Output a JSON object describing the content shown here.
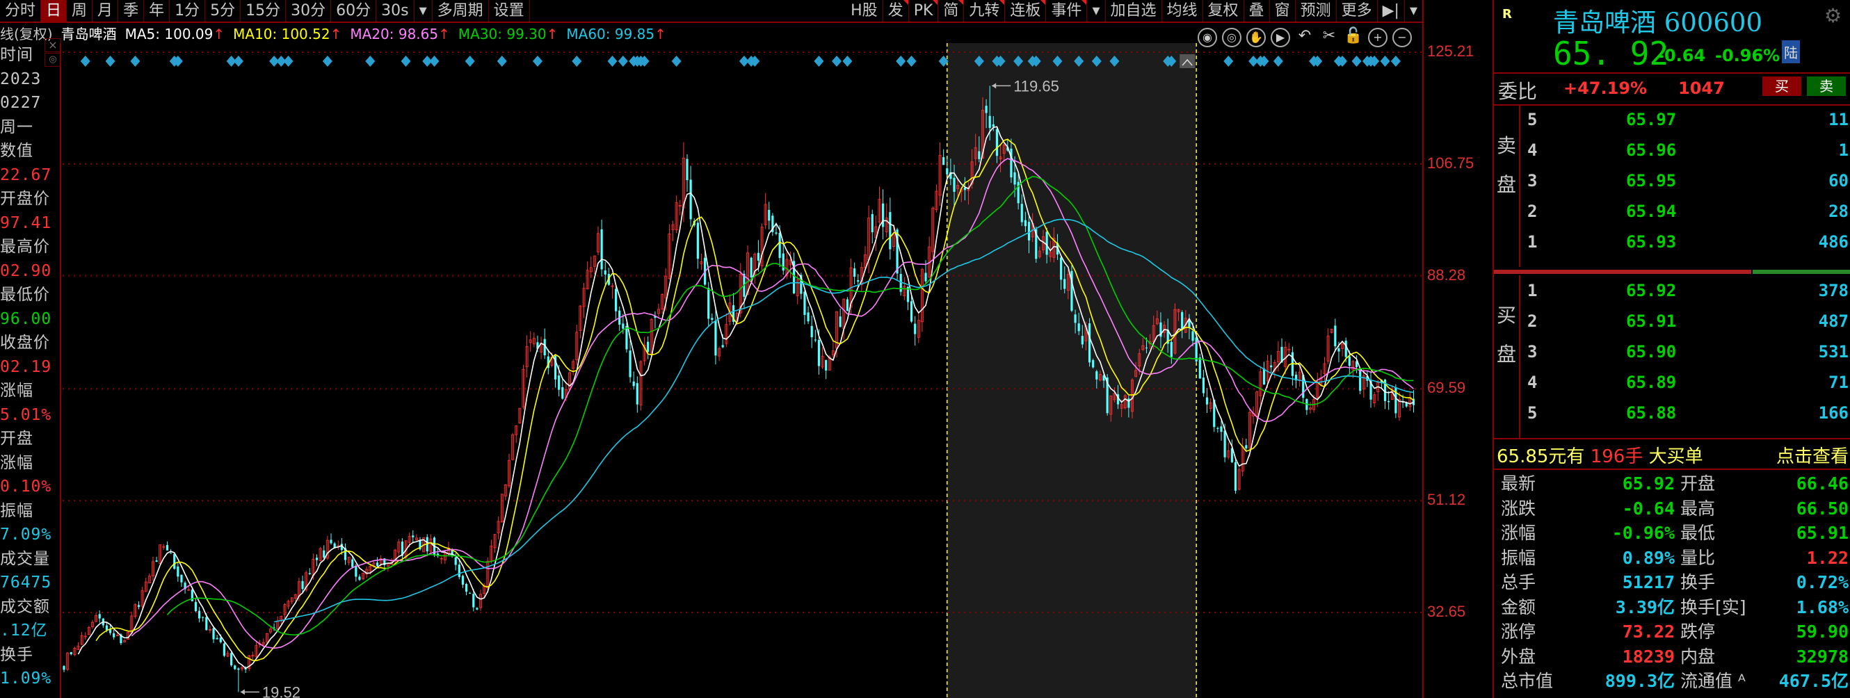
{
  "toolbar": {
    "left": [
      "分时",
      "日",
      "周",
      "月",
      "季",
      "年",
      "1分",
      "5分",
      "15分",
      "30分",
      "60分",
      "30s",
      "▾",
      "多周期",
      "设置"
    ],
    "selected": "日",
    "right": [
      "H股",
      "发",
      "PK",
      "简",
      "九转",
      "连板",
      "事件",
      "▾",
      "加自选",
      "均线",
      "复权",
      "叠",
      "窗",
      "预测",
      "更多",
      "▶|",
      "▾"
    ],
    "flagged": [
      "发",
      "PK",
      "简",
      "九转",
      "连板",
      "事件"
    ]
  },
  "ma_bar": {
    "prefix": "线(复权)",
    "name": "青岛啤酒",
    "arrow": "↑",
    "items": [
      {
        "label": "MA5: 100.09",
        "color": "#ffffff"
      },
      {
        "label": "MA10: 100.52",
        "color": "#ffff00"
      },
      {
        "label": "MA20: 98.65",
        "color": "#ff80ff"
      },
      {
        "label": "MA30: 99.30",
        "color": "#00d000"
      },
      {
        "label": "MA60: 99.85",
        "color": "#1ec8e6"
      }
    ]
  },
  "left_panel": {
    "close": "×",
    "eye": "◎",
    "rows": [
      {
        "t": "时间",
        "c": "#c8c8c8"
      },
      {
        "t": "2023",
        "c": "#c8c8c8"
      },
      {
        "t": "0227",
        "c": "#c8c8c8"
      },
      {
        "t": "周一",
        "c": "#c8c8c8"
      },
      {
        "t": "数值",
        "c": "#c8c8c8"
      },
      {
        "t": "22.67",
        "c": "#ff3232"
      },
      {
        "t": "开盘价",
        "c": "#c8c8c8"
      },
      {
        "t": "97.41",
        "c": "#ff3232"
      },
      {
        "t": "最高价",
        "c": "#c8c8c8"
      },
      {
        "t": "02.90",
        "c": "#ff3232"
      },
      {
        "t": "最低价",
        "c": "#c8c8c8"
      },
      {
        "t": "96.00",
        "c": "#00d000"
      },
      {
        "t": "收盘价",
        "c": "#c8c8c8"
      },
      {
        "t": "02.19",
        "c": "#ff3232"
      },
      {
        "t": "涨幅",
        "c": "#c8c8c8"
      },
      {
        "t": "5.01%",
        "c": "#ff3232"
      },
      {
        "t": "开盘",
        "c": "#c8c8c8"
      },
      {
        "t": "涨幅",
        "c": "#c8c8c8"
      },
      {
        "t": "0.10%",
        "c": "#ff3232"
      },
      {
        "t": "振幅",
        "c": "#c8c8c8"
      },
      {
        "t": "7.09%",
        "c": "#1ec8e6"
      },
      {
        "t": "成交量",
        "c": "#c8c8c8"
      },
      {
        "t": "76475",
        "c": "#1ec8e6"
      },
      {
        "t": "成交额",
        "c": "#c8c8c8"
      },
      {
        "t": ".12亿",
        "c": "#1ec8e6"
      },
      {
        "t": "换手",
        "c": "#c8c8c8"
      },
      {
        "t": "1.09%",
        "c": "#1ec8e6"
      }
    ]
  },
  "chart_tools": [
    "◉",
    "◎",
    "✋",
    "▶",
    "↶",
    "✂",
    "🔓",
    "+",
    "−"
  ],
  "chart_data": {
    "type": "candlestick",
    "y_ticks": [
      125.21,
      106.75,
      88.28,
      69.59,
      51.12,
      32.65
    ],
    "ylim": [
      18.5,
      126.7
    ],
    "candle_count": 380,
    "anchors_index": [
      0,
      1,
      9,
      16,
      28,
      36,
      49,
      59,
      74,
      83,
      99,
      109,
      116,
      123,
      131,
      141,
      149,
      161,
      174,
      183,
      198,
      213,
      229,
      239,
      246,
      253,
      260,
      269,
      279,
      293,
      298,
      306,
      311,
      313,
      323,
      329,
      336,
      343,
      349,
      356,
      366,
      379
    ],
    "anchors_price": [
      24,
      25.4,
      32.2,
      27.4,
      43.9,
      34.2,
      22.5,
      30.3,
      43.9,
      39.1,
      44.9,
      42.0,
      32.2,
      51.8,
      77.2,
      69.3,
      94.7,
      69.3,
      104.5,
      75.2,
      98.6,
      73.3,
      100.6,
      79.1,
      104.5,
      100.6,
      116.2,
      96.7,
      90.8,
      67.4,
      66.4,
      81.1,
      77.2,
      83.0,
      65.4,
      53.7,
      71.3,
      77.2,
      67.4,
      77.2,
      69.3,
      66.9
    ],
    "max_label": "119.65",
    "max_value": 119.65,
    "max_index": 260,
    "min_label": "19.52",
    "min_value": 19.52,
    "min_index": 49,
    "highlight_range": [
      248,
      318
    ],
    "ma_periods": [
      5,
      10,
      20,
      30,
      60
    ],
    "ma_colors": [
      "#ffffff",
      "#ffff00",
      "#ff80ff",
      "#00d000",
      "#1ec8e6"
    ],
    "up_color": "#ff3232",
    "down_color": "#54ffff"
  },
  "quote": {
    "badge": "R",
    "title": "青岛啤酒 600600",
    "price": "65. 92",
    "change": "-0.64",
    "pct": "-0.96%",
    "market": "陆",
    "weibi_label": "委比",
    "weibi": "+47.19%",
    "weicha": "1047",
    "buy": "买",
    "sell": "卖",
    "sell_side": "卖盘",
    "buy_side": "买盘",
    "asks": [
      {
        "n": "5",
        "p": "65.97",
        "q": "11"
      },
      {
        "n": "4",
        "p": "65.96",
        "q": "1"
      },
      {
        "n": "3",
        "p": "65.95",
        "q": "60"
      },
      {
        "n": "2",
        "p": "65.94",
        "q": "28"
      },
      {
        "n": "1",
        "p": "65.93",
        "q": "486"
      }
    ],
    "bids": [
      {
        "n": "1",
        "p": "65.92",
        "q": "378"
      },
      {
        "n": "2",
        "p": "65.91",
        "q": "487"
      },
      {
        "n": "3",
        "p": "65.90",
        "q": "531"
      },
      {
        "n": "4",
        "p": "65.89",
        "q": "71"
      },
      {
        "n": "5",
        "p": "65.88",
        "q": "166"
      }
    ],
    "order_ratio": 0.72,
    "big_order": {
      "price": "65.85元有",
      "qty": "196手",
      "label": "大买单",
      "link": "点击查看"
    },
    "stats": [
      {
        "l": "最新",
        "v": "65.92",
        "c": "#00d000",
        "l2": "开盘",
        "v2": "66.46",
        "c2": "#00d000"
      },
      {
        "l": "涨跌",
        "v": "-0.64",
        "c": "#00d000",
        "l2": "最高",
        "v2": "66.50",
        "c2": "#00d000"
      },
      {
        "l": "涨幅",
        "v": "-0.96%",
        "c": "#00d000",
        "l2": "最低",
        "v2": "65.91",
        "c2": "#00d000"
      },
      {
        "l": "振幅",
        "v": "0.89%",
        "c": "#1ec8e6",
        "l2": "量比",
        "v2": "1.22",
        "c2": "#ff3232"
      },
      {
        "l": "总手",
        "v": "51217",
        "c": "#1ec8e6",
        "l2": "换手",
        "v2": "0.72%",
        "c2": "#1ec8e6"
      },
      {
        "l": "金额",
        "v": "3.39亿",
        "c": "#1ec8e6",
        "l2": "换手[实]",
        "v2": "1.68%",
        "c2": "#1ec8e6"
      },
      {
        "l": "涨停",
        "v": "73.22",
        "c": "#ff3232",
        "l2": "跌停",
        "v2": "59.90",
        "c2": "#00d000"
      },
      {
        "l": "外盘",
        "v": "18239",
        "c": "#ff3232",
        "l2": "内盘",
        "v2": "32978",
        "c2": "#00d000"
      },
      {
        "l": "总市值",
        "v": "899.3亿",
        "c": "#1ec8e6",
        "l2": "流通值 ᴬ",
        "v2": "467.5亿",
        "c2": "#1ec8e6"
      }
    ]
  }
}
